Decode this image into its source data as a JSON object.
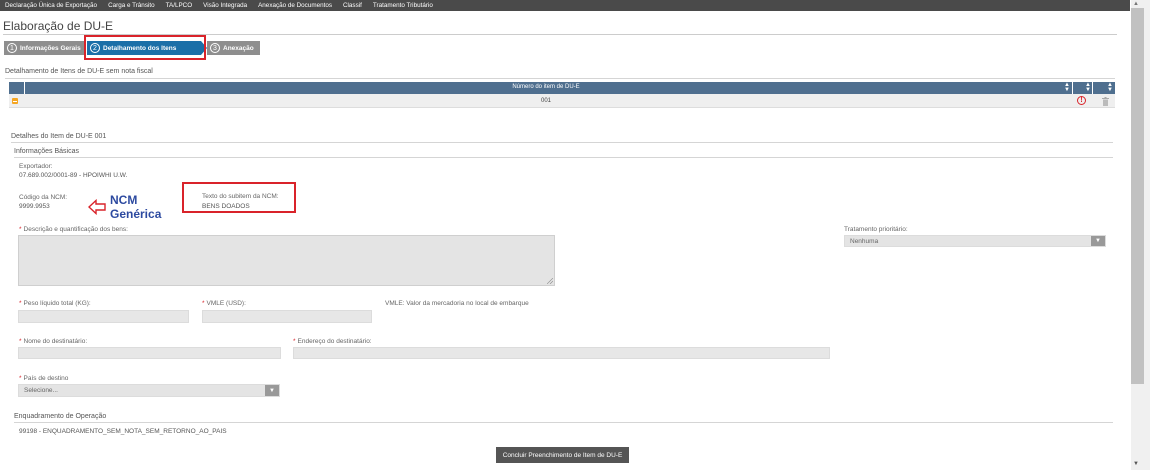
{
  "topnav": [
    "Declaração Única de Exportação",
    "Carga e Trânsito",
    "TA/LPCO",
    "Visão Integrada",
    "Anexação de Documentos",
    "Classif",
    "Tratamento Tributário"
  ],
  "page": {
    "title": "Elaboração de DU-E"
  },
  "steps": [
    {
      "num": "1",
      "label": "Informações Gerais"
    },
    {
      "num": "2",
      "label": "Detalhamento dos Itens"
    },
    {
      "num": "3",
      "label": "Anexação"
    }
  ],
  "items_section": {
    "title": "Detalhamento de Itens de DU-E sem nota fiscal",
    "column_header": "Número do item de DU-E",
    "rows": [
      {
        "numero": "001"
      }
    ]
  },
  "details": {
    "title": "Detalhes do Item de DU-E 001",
    "basic_info_title": "Informações Básicas",
    "exportador_label": "Exportador:",
    "exportador_value": "07.689.002/0001-89 - HPOIWHI U.W.",
    "ncm_label": "Código da NCM:",
    "ncm_value": "9999.9953",
    "texto_subitem_label": "Texto do subitem da NCM:",
    "texto_subitem_value": "BENS DOADOS",
    "descricao_label": "Descrição e quantificação dos bens:",
    "tratamento_label": "Tratamento prioritário:",
    "tratamento_value": "Nenhuma",
    "peso_label": "Peso líquido total (KG):",
    "vmle_label": "VMLE (USD):",
    "vmle_note": "VMLE: Valor da mercadoria no local de embarque",
    "nome_dest_label": "Nome do destinatário:",
    "endereco_dest_label": "Endereço do destinatário:",
    "pais_label": "País de destino",
    "pais_placeholder": "Selecione...",
    "enquadramento_title": "Enquadramento de Operação",
    "enquadramento_value": "99198 - ENQUADRAMENTO_SEM_NOTA_SEM_RETORNO_AO_PAIS"
  },
  "annotation": {
    "line1": "NCM",
    "line2": "Genérica"
  },
  "buttons": {
    "concluir": "Concluir Preenchimento de Item de DU-E"
  },
  "colors": {
    "step_active": "#1b6fa8",
    "step_inactive": "#8e8e8e",
    "table_header": "#4f6f8f",
    "highlight": "#d9232a",
    "annotation_text": "#2d4aa0"
  }
}
